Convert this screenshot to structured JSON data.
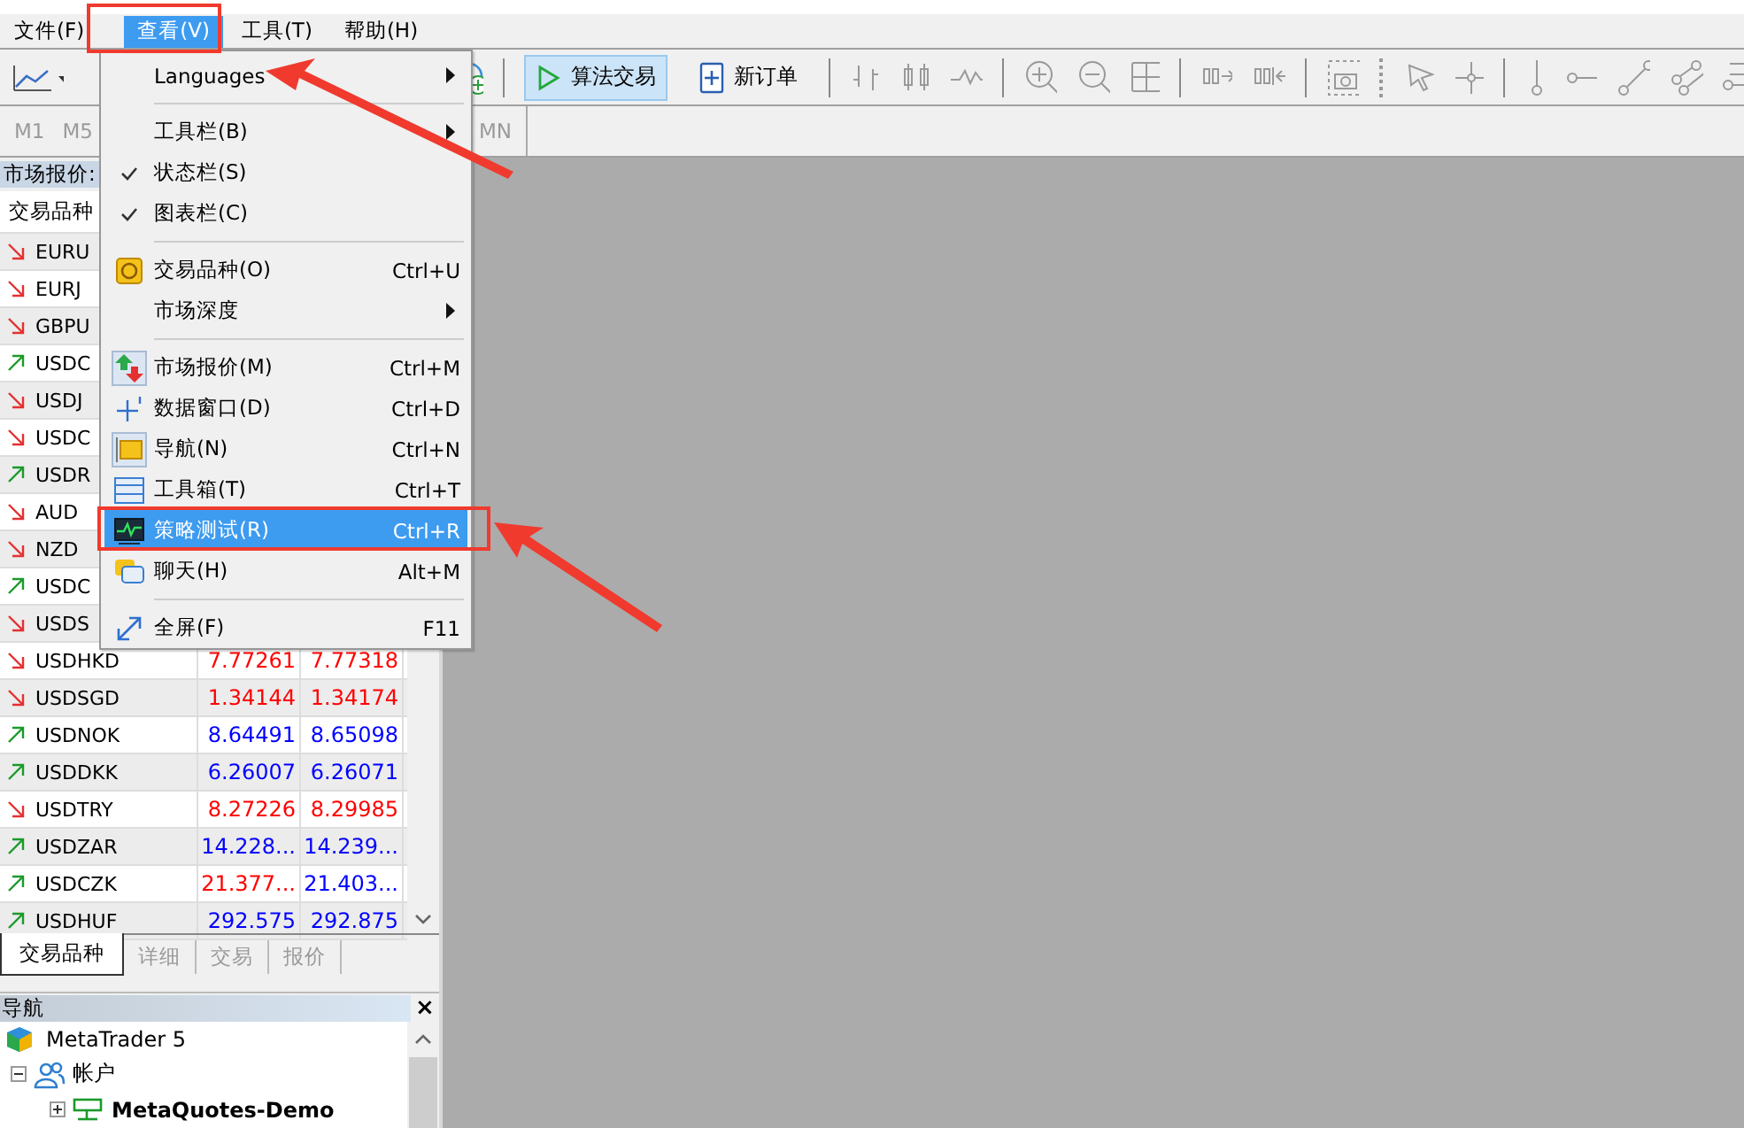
{
  "menu_bar": [
    {
      "label": "文件(F)",
      "selected": false
    },
    {
      "label": "查看(V)",
      "selected": true
    },
    {
      "label": "工具(T)",
      "selected": false
    },
    {
      "label": "帮助(H)",
      "selected": false
    }
  ],
  "toolbar": {
    "buttons": [
      {
        "label": "算法交易",
        "pressed": true
      },
      {
        "label": "新订单",
        "pressed": false
      }
    ]
  },
  "timeframes": [
    {
      "label": "M1"
    },
    {
      "label": "M5"
    },
    {
      "label": "MN"
    }
  ],
  "market_watch": {
    "title": "市场报价:",
    "header": "交易品种",
    "rows": [
      {
        "symbol": "EURU",
        "rising": false
      },
      {
        "symbol": "EURJ",
        "rising": false
      },
      {
        "symbol": "GBPU",
        "rising": false
      },
      {
        "symbol": "USDC",
        "rising": true
      },
      {
        "symbol": "USDJ",
        "rising": false
      },
      {
        "symbol": "USDC",
        "rising": false
      },
      {
        "symbol": "USDR",
        "rising": true
      },
      {
        "symbol": "AUD",
        "rising": false
      },
      {
        "symbol": "NZD",
        "rising": false
      },
      {
        "symbol": "USDC",
        "rising": true
      },
      {
        "symbol": "USDS",
        "rising": false
      },
      {
        "symbol": "USDHKD",
        "rising": false,
        "bid": {
          "text": "7.77261",
          "color": "#ff0000"
        },
        "ask": {
          "text": "7.77318",
          "color": "#ff0000"
        }
      },
      {
        "symbol": "USDSGD",
        "rising": false,
        "bid": {
          "text": "1.34144",
          "color": "#ff0000"
        },
        "ask": {
          "text": "1.34174",
          "color": "#ff0000"
        }
      },
      {
        "symbol": "USDNOK",
        "rising": true,
        "bid": {
          "text": "8.64491",
          "color": "#0000ff"
        },
        "ask": {
          "text": "8.65098",
          "color": "#0000ff"
        }
      },
      {
        "symbol": "USDDKK",
        "rising": true,
        "bid": {
          "text": "6.26007",
          "color": "#0000ff"
        },
        "ask": {
          "text": "6.26071",
          "color": "#0000ff"
        }
      },
      {
        "symbol": "USDTRY",
        "rising": false,
        "bid": {
          "text": "8.27226",
          "color": "#ff0000"
        },
        "ask": {
          "text": "8.29985",
          "color": "#ff0000"
        }
      },
      {
        "symbol": "USDZAR",
        "rising": true,
        "bid": {
          "text": "14.228...",
          "color": "#0000ff"
        },
        "ask": {
          "text": "14.239...",
          "color": "#0000ff"
        }
      },
      {
        "symbol": "USDCZK",
        "rising": true,
        "bid": {
          "text": "21.377...",
          "color": "#ff0000"
        },
        "ask": {
          "text": "21.403...",
          "color": "#0000ff"
        }
      },
      {
        "symbol": "USDHUF",
        "rising": true,
        "bid": {
          "text": "292.575",
          "color": "#0000ff"
        },
        "ask": {
          "text": "292.875",
          "color": "#0000ff"
        }
      }
    ]
  },
  "market_tabs": [
    {
      "label": "交易品种",
      "selected": true
    },
    {
      "label": "详细",
      "selected": false
    },
    {
      "label": "交易",
      "selected": false
    },
    {
      "label": "报价",
      "selected": false
    }
  ],
  "navigator": {
    "title": "导航",
    "close": "×",
    "tree": [
      {
        "label": "MetaTrader 5",
        "children": [
          {
            "label": "帐户",
            "expanded": true,
            "children": [
              {
                "label": "MetaQuotes-Demo",
                "expanded": false,
                "bold": true
              }
            ]
          }
        ]
      }
    ]
  },
  "view_menu": {
    "items": [
      {
        "kind": "item",
        "label": "Languages",
        "submenu": true,
        "checked": false,
        "selected": false
      },
      {
        "kind": "separator"
      },
      {
        "kind": "item",
        "label": "工具栏(B)",
        "submenu": true,
        "checked": false,
        "selected": false
      },
      {
        "kind": "item",
        "label": "状态栏(S)",
        "checked": true,
        "selected": false
      },
      {
        "kind": "item",
        "label": "图表栏(C)",
        "checked": true,
        "selected": false
      },
      {
        "kind": "separator"
      },
      {
        "kind": "item",
        "label": "交易品种(O)",
        "shortcut": "Ctrl+U",
        "checked": false,
        "selected": false
      },
      {
        "kind": "item",
        "label": "市场深度",
        "submenu": true,
        "checked": false,
        "selected": false
      },
      {
        "kind": "separator"
      },
      {
        "kind": "item",
        "label": "市场报价(M)",
        "shortcut": "Ctrl+M",
        "checked": false,
        "selected": false
      },
      {
        "kind": "item",
        "label": "数据窗口(D)",
        "shortcut": "Ctrl+D",
        "checked": false,
        "selected": false
      },
      {
        "kind": "item",
        "label": "导航(N)",
        "shortcut": "Ctrl+N",
        "checked": false,
        "selected": false
      },
      {
        "kind": "item",
        "label": "工具箱(T)",
        "shortcut": "Ctrl+T",
        "checked": false,
        "selected": false
      },
      {
        "kind": "item",
        "label": "策略测试(R)",
        "shortcut": "Ctrl+R",
        "checked": false,
        "selected": true
      },
      {
        "kind": "item",
        "label": "聊天(H)",
        "shortcut": "Alt+M",
        "checked": false,
        "selected": false
      },
      {
        "kind": "separator"
      },
      {
        "kind": "item",
        "label": "全屏(F)",
        "shortcut": "F11",
        "checked": false,
        "selected": false
      }
    ]
  }
}
